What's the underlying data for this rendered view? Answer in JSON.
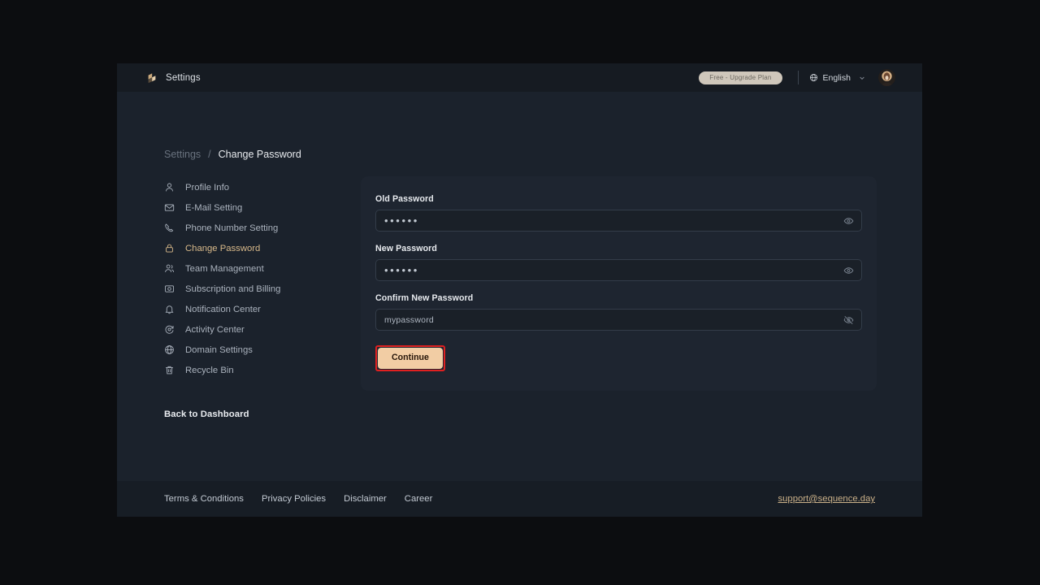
{
  "header": {
    "title": "Settings",
    "plan_pill": "Free - Upgrade Plan",
    "language": "English"
  },
  "breadcrumb": {
    "root": "Settings",
    "separator": "/",
    "current": "Change Password"
  },
  "sidebar": {
    "items": [
      {
        "label": "Profile Info"
      },
      {
        "label": "E-Mail Setting"
      },
      {
        "label": "Phone Number Setting"
      },
      {
        "label": "Change Password"
      },
      {
        "label": "Team Management"
      },
      {
        "label": "Subscription and Billing"
      },
      {
        "label": "Notification Center"
      },
      {
        "label": "Activity Center"
      },
      {
        "label": "Domain Settings"
      },
      {
        "label": "Recycle Bin"
      }
    ],
    "active_item": "Change Password",
    "back_link": "Back to Dashboard"
  },
  "form": {
    "fields": [
      {
        "label": "Old Password",
        "value": "••••••",
        "masked": true
      },
      {
        "label": "New Password",
        "value": "••••••",
        "masked": true
      },
      {
        "label": "Confirm New Password",
        "value": "mypassword",
        "masked": false
      }
    ],
    "submit_label": "Continue"
  },
  "footer": {
    "links": [
      "Terms & Conditions",
      "Privacy Policies",
      "Disclaimer",
      "Career"
    ],
    "support_email": "support@sequence.day"
  },
  "colors": {
    "accent": "#d8b98a",
    "button_bg": "#f2cda4",
    "highlight_outline": "#e02020",
    "page_bg": "#1b222c",
    "card_bg": "#1e2530",
    "header_bg": "#161b22",
    "footer_bg": "#171d25",
    "letterbox": "#0c0d10"
  }
}
